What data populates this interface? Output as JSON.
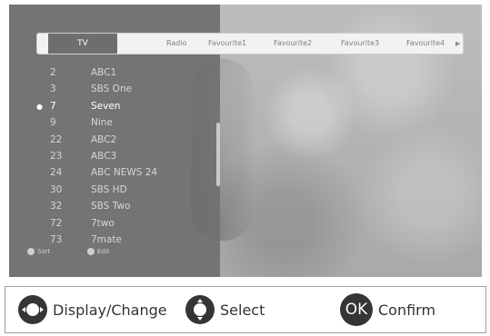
{
  "tabs": {
    "items": [
      "TV",
      "Radio",
      "Favourite1",
      "Favourite2",
      "Favourite3",
      "Favourite4"
    ],
    "active": "TV",
    "scroll_icon": "arrow-right-icon"
  },
  "channels": [
    {
      "number": "2",
      "name": "ABC1",
      "selected": false
    },
    {
      "number": "3",
      "name": "SBS One",
      "selected": false
    },
    {
      "number": "7",
      "name": "Seven",
      "selected": true
    },
    {
      "number": "9",
      "name": "Nine",
      "selected": false
    },
    {
      "number": "22",
      "name": "ABC2",
      "selected": false
    },
    {
      "number": "23",
      "name": "ABC3",
      "selected": false
    },
    {
      "number": "24",
      "name": "ABC NEWS 24",
      "selected": false
    },
    {
      "number": "30",
      "name": "SBS HD",
      "selected": false
    },
    {
      "number": "32",
      "name": "SBS Two",
      "selected": false
    },
    {
      "number": "72",
      "name": "7two",
      "selected": false
    },
    {
      "number": "73",
      "name": "7mate",
      "selected": false
    }
  ],
  "hints": {
    "sort": "Sort",
    "edit": "Edit"
  },
  "legend": {
    "display_change": "Display/Change",
    "select": "Select",
    "ok_symbol": "OK",
    "confirm": "Confirm"
  }
}
